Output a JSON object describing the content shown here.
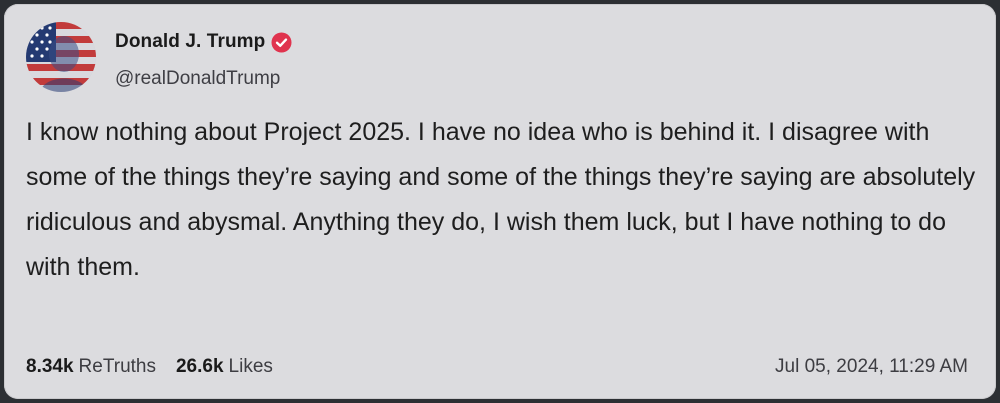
{
  "post": {
    "author_name": "Donald J. Trump",
    "handle": "@realDonaldTrump",
    "text": "I know nothing about Project 2025. I have no idea who is behind it. I disagree with some of the things they’re saying and some of the things they’re saying are absolutely ridiculous and abysmal. Anything they do, I wish them luck, but I have nothing to do with them.",
    "retruths_count": "8.34k",
    "retruths_label": "ReTruths",
    "likes_count": "26.6k",
    "likes_label": "Likes",
    "timestamp": "Jul 05, 2024, 11:29 AM"
  },
  "icons": {
    "avatar": "flag-portrait-avatar",
    "verified": "verified-badge-icon"
  },
  "colors": {
    "card_background": "#dcdcdf",
    "verified_badge": "#e0334e",
    "text_primary": "#1e1e1e",
    "text_secondary": "#3d3d42"
  }
}
